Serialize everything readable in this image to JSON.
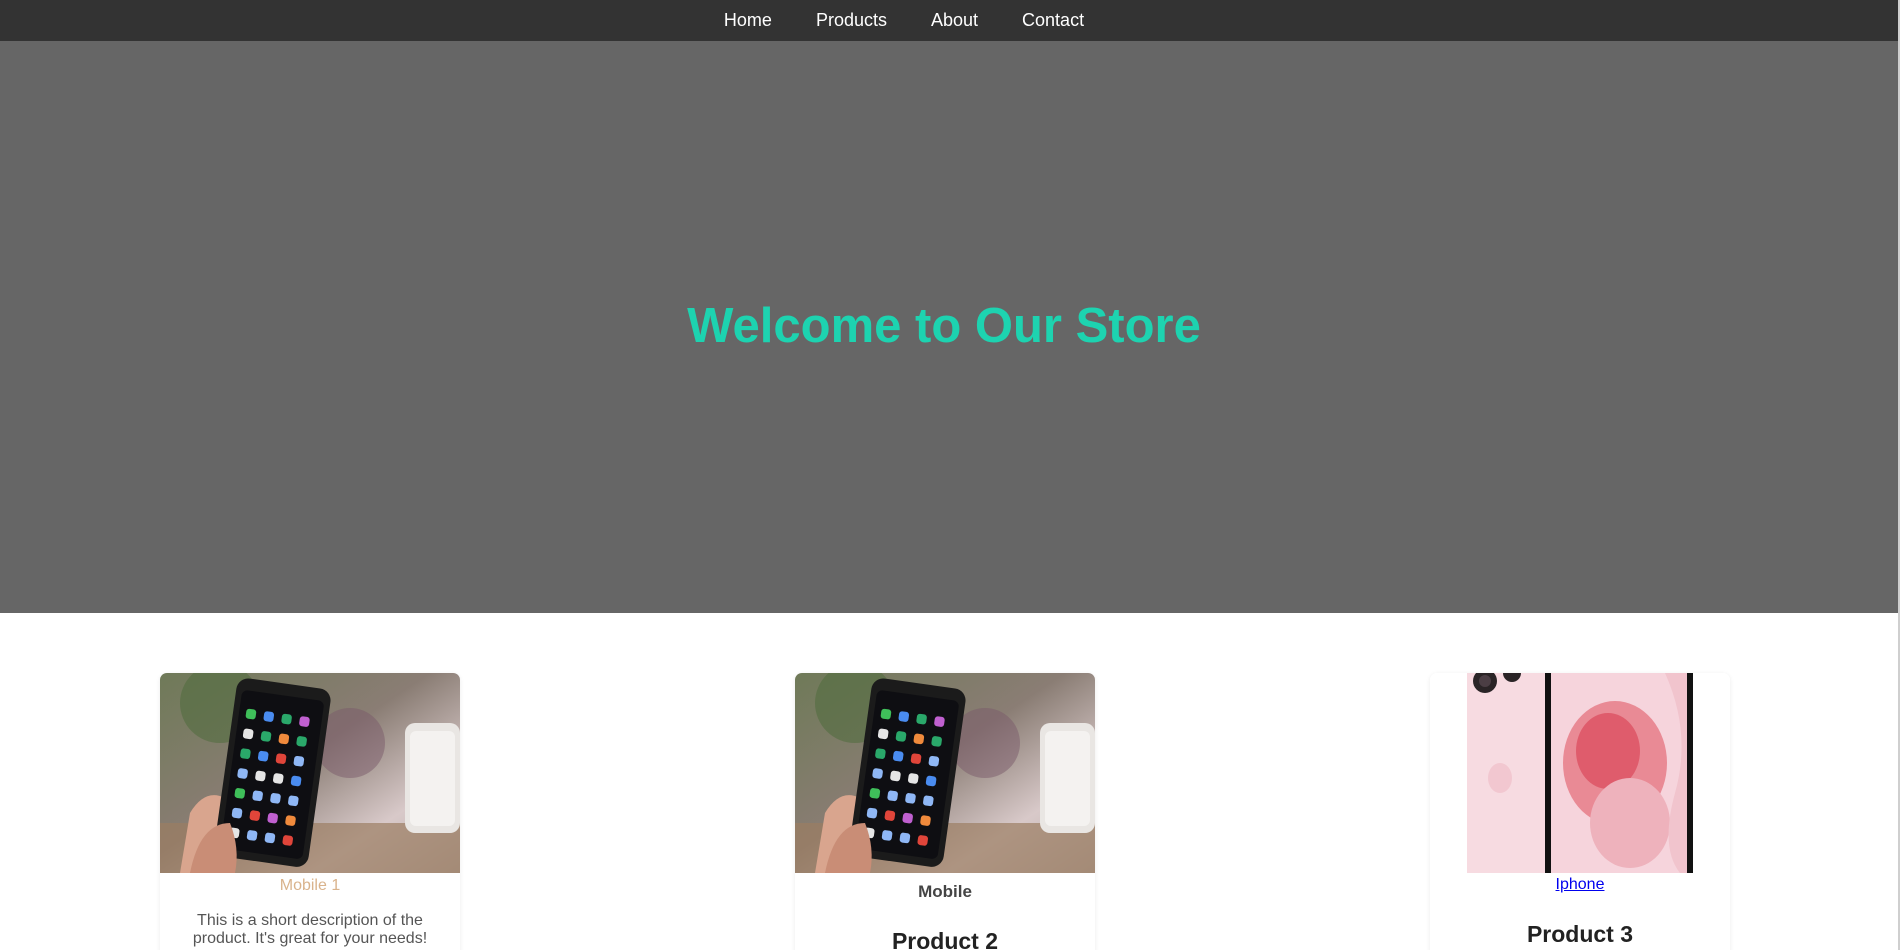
{
  "nav": {
    "items": [
      {
        "label": "Home"
      },
      {
        "label": "Products"
      },
      {
        "label": "About"
      },
      {
        "label": "Contact"
      }
    ]
  },
  "hero": {
    "title": "Welcome to Our Store"
  },
  "products": [
    {
      "image_alt": "Mobile 1",
      "caption": "Mobile 1",
      "description": "This is a short description of the product. It's great for your needs!"
    },
    {
      "image_alt": "Mobile",
      "caption": "Mobile",
      "title": "Product 2"
    },
    {
      "image_alt": "Iphone",
      "caption": "Iphone",
      "title": "Product 3"
    }
  ],
  "colors": {
    "nav_bg": "#333333",
    "hero_bg": "#666666",
    "hero_title": "#1dd3b0",
    "caption_tan": "#d9b38c",
    "link_blue": "#0000ee"
  }
}
